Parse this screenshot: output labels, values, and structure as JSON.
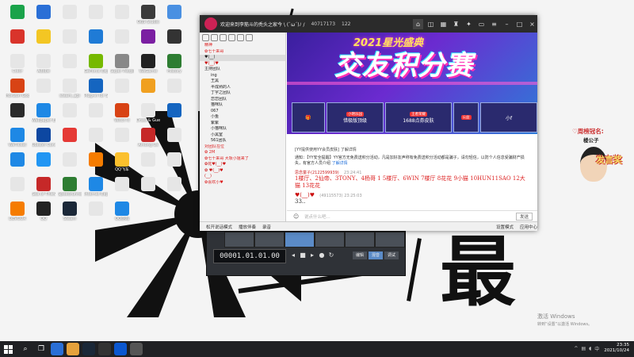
{
  "desktop": {
    "icons": [
      {
        "label": "",
        "color": "#1aa34a"
      },
      {
        "label": "",
        "color": "#2a6fd6"
      },
      {
        "label": "",
        "color": "#e6e6e6"
      },
      {
        "label": "",
        "color": "#e6e6e6"
      },
      {
        "label": "",
        "color": "#e6e6e6"
      },
      {
        "label": "OBS Studio",
        "color": "#3b3b3b"
      },
      {
        "label": "",
        "color": "#4a90e2"
      },
      {
        "label": "",
        "color": "#d9342b"
      },
      {
        "label": "",
        "color": "#f3c623"
      },
      {
        "label": "",
        "color": "#e6e6e6"
      },
      {
        "label": "",
        "color": "#1f7bd6"
      },
      {
        "label": "",
        "color": "#e6e6e6"
      },
      {
        "label": "",
        "color": "#7b1fa2"
      },
      {
        "label": "",
        "color": "#333"
      },
      {
        "label": "Color",
        "color": "#e6e6e6"
      },
      {
        "label": "Adobe",
        "color": "#e6e6e6"
      },
      {
        "label": "",
        "color": "#e6e6e6"
      },
      {
        "label": "GeForce Experience",
        "color": "#76b900"
      },
      {
        "label": "Super People",
        "color": "#888"
      },
      {
        "label": "WeGame",
        "color": "#222"
      },
      {
        "label": "History",
        "color": "#2e7d32"
      },
      {
        "label": "Horizon Google Me",
        "color": "#d84315"
      },
      {
        "label": "",
        "color": "#e6e6e6"
      },
      {
        "label": "steam_api",
        "color": "#e6e6e6"
      },
      {
        "label": "Plug-in for Steam",
        "color": "#1565c0"
      },
      {
        "label": "",
        "color": "#e6e6e6"
      },
      {
        "label": "",
        "color": "#f0a020"
      },
      {
        "label": "",
        "color": "#e6e6e6"
      },
      {
        "label": "",
        "color": "#2b2b2b"
      },
      {
        "label": "Wallpaper Engine",
        "color": "#1e88e5"
      },
      {
        "label": "",
        "color": "#e6e6e6"
      },
      {
        "label": "",
        "color": "#e6e6e6"
      },
      {
        "label": "Witch It",
        "color": "#d84315"
      },
      {
        "label": "Draw & Guess",
        "color": "#e6e6e6"
      },
      {
        "label": "",
        "color": "#1565c0"
      },
      {
        "label": "WeTicket",
        "color": "#1e88e5"
      },
      {
        "label": "Ubisoft Connect",
        "color": "#0d47a1"
      },
      {
        "label": "",
        "color": "#e53935"
      },
      {
        "label": "",
        "color": "#e6e6e6"
      },
      {
        "label": "",
        "color": "#e6e6e6"
      },
      {
        "label": "Among Us",
        "color": "#c62828"
      },
      {
        "label": "",
        "color": "#e6e6e6"
      },
      {
        "label": "",
        "color": "#1e88e5"
      },
      {
        "label": "",
        "color": "#2196f3"
      },
      {
        "label": "",
        "color": "#e6e6e6"
      },
      {
        "label": "",
        "color": "#f57c00"
      },
      {
        "label": "QQ飞车",
        "color": "#fbc02d"
      },
      {
        "label": "",
        "color": "#e6e6e6"
      },
      {
        "label": "",
        "color": "#e6e6e6"
      },
      {
        "label": "",
        "color": "#e6e6e6"
      },
      {
        "label": "Sea of Thieves",
        "color": "#c62828"
      },
      {
        "label": "Speedrunner",
        "color": "#2e7d32"
      },
      {
        "label": "Internet Explorer",
        "color": "#1e88e5"
      },
      {
        "label": "",
        "color": "#e6e6e6"
      },
      {
        "label": "",
        "color": "#e6e6e6"
      },
      {
        "label": "",
        "color": "#e6e6e6"
      },
      {
        "label": "DEVOUR",
        "color": "#f57c00"
      },
      {
        "label": "QQ",
        "color": "#222"
      },
      {
        "label": "Steam",
        "color": "#1b2838"
      },
      {
        "label": "",
        "color": "#e6e6e6"
      },
      {
        "label": "QQ游戏",
        "color": "#1e88e5"
      }
    ],
    "big_char": "最",
    "activation_line1": "激活 Windows",
    "activation_line2": "转到“设置”以激活 Windows。"
  },
  "chat_window": {
    "title": "欢迎来到李筋斗的秃头之家今 \\ (`ω´)ﾉ /",
    "room_id": "40717173",
    "online_count": "122",
    "sidebar": {
      "rows": [
        {
          "text": "精神",
          "cls": "red"
        },
        {
          "text": "✿七十来哥",
          "cls": "red"
        },
        {
          "text": "♥(__)",
          "cls": "hl"
        },
        {
          "text": "♥(__)♥",
          "cls": "hearts"
        },
        {
          "text": "主持团队",
          "cls": ""
        },
        {
          "text": "ing",
          "cls": "sub"
        },
        {
          "text": "王黑",
          "cls": "sub"
        },
        {
          "text": "半成熟的人",
          "cls": "sub"
        },
        {
          "text": "丁字之团队",
          "cls": "sub"
        },
        {
          "text": "恋恋团队",
          "cls": "sub"
        },
        {
          "text": "猫咪队",
          "cls": "sub"
        },
        {
          "text": "067",
          "cls": "sub"
        },
        {
          "text": "小鱼",
          "cls": "sub"
        },
        {
          "text": "紫紫",
          "cls": "sub"
        },
        {
          "text": "小猫咪队",
          "cls": "sub"
        },
        {
          "text": "小黑室",
          "cls": "sub"
        },
        {
          "text": "561团队",
          "cls": "sub"
        },
        {
          "text": "对团队在位",
          "cls": "red"
        },
        {
          "text": "✿ 2M",
          "cls": "red"
        },
        {
          "text": "✿七十来哥  大坂小姐来了",
          "cls": "red"
        },
        {
          "text": "✿花♥(__)♥",
          "cls": "hearts"
        },
        {
          "text": "✿ ♥(__)♥",
          "cls": "hearts"
        },
        {
          "text": "(__)",
          "cls": "hearts"
        },
        {
          "text": "✿喜欢小♥",
          "cls": "red"
        }
      ]
    },
    "banner": {
      "line1": "2021星光盛典",
      "line2": "交友积分赛",
      "cards": [
        {
          "label": "惜极版顶级",
          "tag": "小明乐园"
        },
        {
          "label": "1688点券皮肤",
          "tag": "王者荣耀"
        },
        {
          "label": "小f",
          "tag": "公益"
        }
      ]
    },
    "chat": {
      "notice": "[YY提供使用YY会员皮肤] 了解详情",
      "system_text": "通知：【YY安全提醒】YY官方无免费送积分活动，凡是加好友声称有免费送积分活动都是骗子，请勿轻信，以防个人信息受骗财产损失，有官方人员介绍",
      "link_text": "了解详情",
      "messages": [
        {
          "who": "思念童子(2122599939)",
          "time": "23:24:41",
          "body": "1楼厅、2仙帝、3TONY、4杨哥 1 5楼厅、6WIN 7楼厅 8花花  9小猫  10HUN11SAO 12大猫  13花花"
        },
        {
          "who": "♥(__)♥",
          "time": "(49115573)   23:25:03",
          "body": "33.."
        }
      ]
    },
    "input_placeholder": "说点什么吧...",
    "send_label": "发送",
    "status": {
      "items": [
        "松开说话模式",
        "播放伴奏",
        "录音",
        "设置模式",
        "应用中心"
      ]
    }
  },
  "studio": {
    "timecode": "00001.01.01.00",
    "tracks": [
      "",
      "",
      "",
      "",
      "",
      "",
      ""
    ],
    "tabs": [
      "编辑",
      "混音",
      "调试"
    ]
  },
  "sticker": {
    "line1": "♡周榜冠名:",
    "line2": "楼公子",
    "art": "发言奖"
  },
  "taskbar": {
    "clock_time": "23:35",
    "clock_date": "2021/10/24"
  }
}
